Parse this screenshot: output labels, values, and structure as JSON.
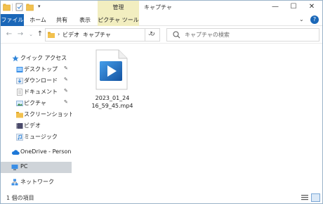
{
  "titlebar": {
    "manage_tab": "管理",
    "title": "キャプチャ",
    "minimize": "—",
    "maximize": "☐",
    "close": "✕"
  },
  "ribbon": {
    "tabs": [
      "ファイル",
      "ホーム",
      "共有",
      "表示",
      "ピクチャ ツール"
    ],
    "expand": "⌄",
    "help": "?"
  },
  "addressbar": {
    "back": "←",
    "forward": "→",
    "recent": "⌄",
    "up": "↑",
    "separator": "›",
    "segments": [
      "ビデオ",
      "キャプチャ"
    ],
    "dropdown": "⌄",
    "refresh": "↻"
  },
  "search": {
    "placeholder": "キャプチャの検索"
  },
  "navpane": {
    "quick_access": "クイック アクセス",
    "items": [
      {
        "label": "デスクトップ",
        "pinned": true,
        "icon": "desktop-icon"
      },
      {
        "label": "ダウンロード",
        "pinned": true,
        "icon": "download-icon"
      },
      {
        "label": "ドキュメント",
        "pinned": true,
        "icon": "documents-icon"
      },
      {
        "label": "ピクチャ",
        "pinned": true,
        "icon": "pictures-icon"
      },
      {
        "label": "スクリーンショット",
        "pinned": false,
        "icon": "folder-icon"
      },
      {
        "label": "ビデオ",
        "pinned": false,
        "icon": "videos-icon"
      },
      {
        "label": "ミュージック",
        "pinned": false,
        "icon": "music-icon"
      }
    ],
    "pin_glyph": "✎",
    "onedrive": "OneDrive - Personal",
    "pc": "PC",
    "network": "ネットワーク"
  },
  "content": {
    "files": [
      {
        "name_line1": "2023_01_24",
        "name_line2": "16_59_45.mp4",
        "icon": "video-file-icon"
      }
    ]
  },
  "statusbar": {
    "item_count": "1 個の項目"
  },
  "colors": {
    "accent": "#1a67b8",
    "manage_tab_bg": "#f2eec0",
    "selected_nav_bg": "#cfd4d9"
  }
}
